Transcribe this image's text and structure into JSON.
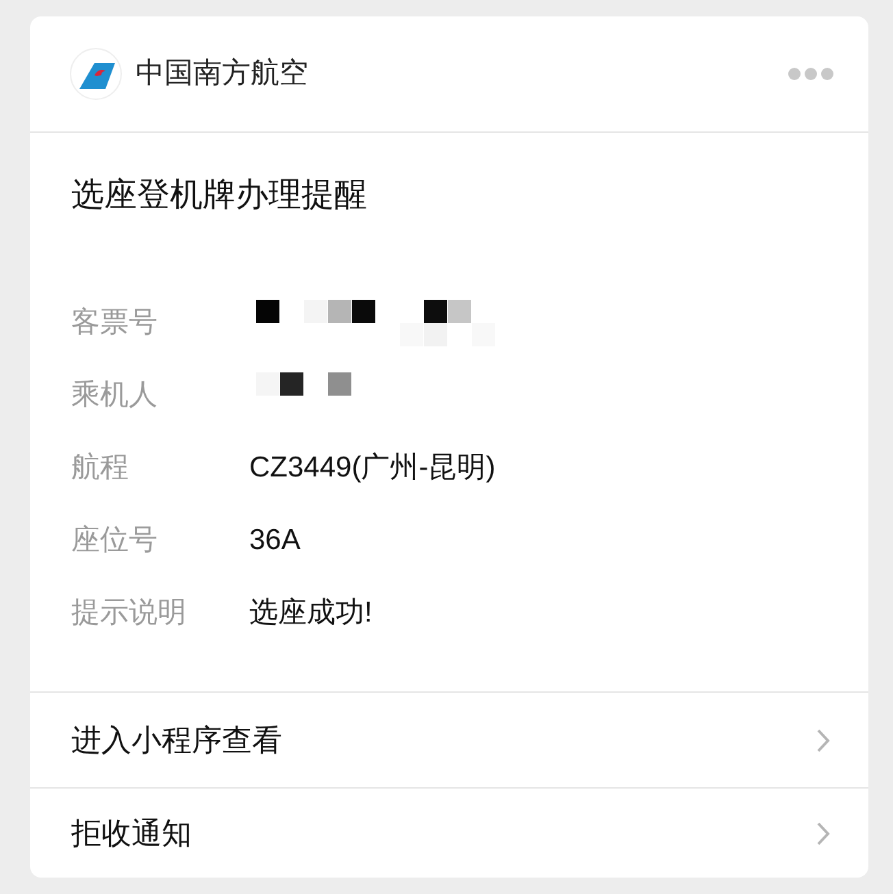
{
  "header": {
    "account_name": "中国南方航空"
  },
  "title": "选座登机牌办理提醒",
  "fields": [
    {
      "label": "客票号",
      "kind": "redacted"
    },
    {
      "label": "乘机人",
      "kind": "redacted"
    },
    {
      "label": "航程",
      "kind": "text",
      "value": "CZ3449(广州-昆明)"
    },
    {
      "label": "座位号",
      "kind": "text",
      "value": "36A"
    },
    {
      "label": "提示说明",
      "kind": "text",
      "value": "选座成功!"
    }
  ],
  "actions": [
    {
      "label": "进入小程序查看"
    },
    {
      "label": "拒收通知"
    }
  ]
}
